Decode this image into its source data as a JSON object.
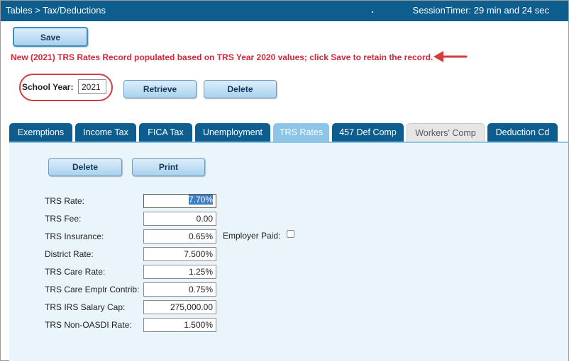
{
  "topbar": {
    "breadcrumb": "Tables > Tax/Deductions",
    "session_timer": "SessionTimer: 29 min and 24 sec"
  },
  "actions": {
    "save_label": "Save",
    "retrieve_label": "Retrieve",
    "delete_label": "Delete"
  },
  "message": {
    "text": "New (2021) TRS Rates Record populated based on TRS Year 2020 values; click Save to retain the record.",
    "color": "#d3283a"
  },
  "school_year": {
    "label": "School Year:",
    "value": "2021"
  },
  "tabs": [
    {
      "label": "Exemptions"
    },
    {
      "label": "Income Tax"
    },
    {
      "label": "FICA Tax"
    },
    {
      "label": "Unemployment"
    },
    {
      "label": "TRS Rates"
    },
    {
      "label": "457 Def Comp"
    },
    {
      "label": "Workers' Comp"
    },
    {
      "label": "Deduction Cd"
    }
  ],
  "panel": {
    "delete_label": "Delete",
    "print_label": "Print",
    "fields": [
      {
        "label": "TRS Rate:",
        "value": "7.70%"
      },
      {
        "label": "TRS Fee:",
        "value": "0.00"
      },
      {
        "label": "TRS Insurance:",
        "value": "0.65%"
      },
      {
        "label": "District Rate:",
        "value": "7.500%"
      },
      {
        "label": "TRS Care Rate:",
        "value": "1.25%"
      },
      {
        "label": "TRS Care Emplr Contrib:",
        "value": "0.75%"
      },
      {
        "label": "TRS IRS Salary Cap:",
        "value": "275,000.00"
      },
      {
        "label": "TRS Non-OASDI Rate:",
        "value": "1.500%"
      }
    ],
    "employer_paid_label": "Employer Paid:"
  },
  "colors": {
    "header_blue": "#0d5d8e",
    "active_tab": "#8cc5e8",
    "panel_bg": "#eaf4fb",
    "annotation_red": "#d63b3b"
  }
}
